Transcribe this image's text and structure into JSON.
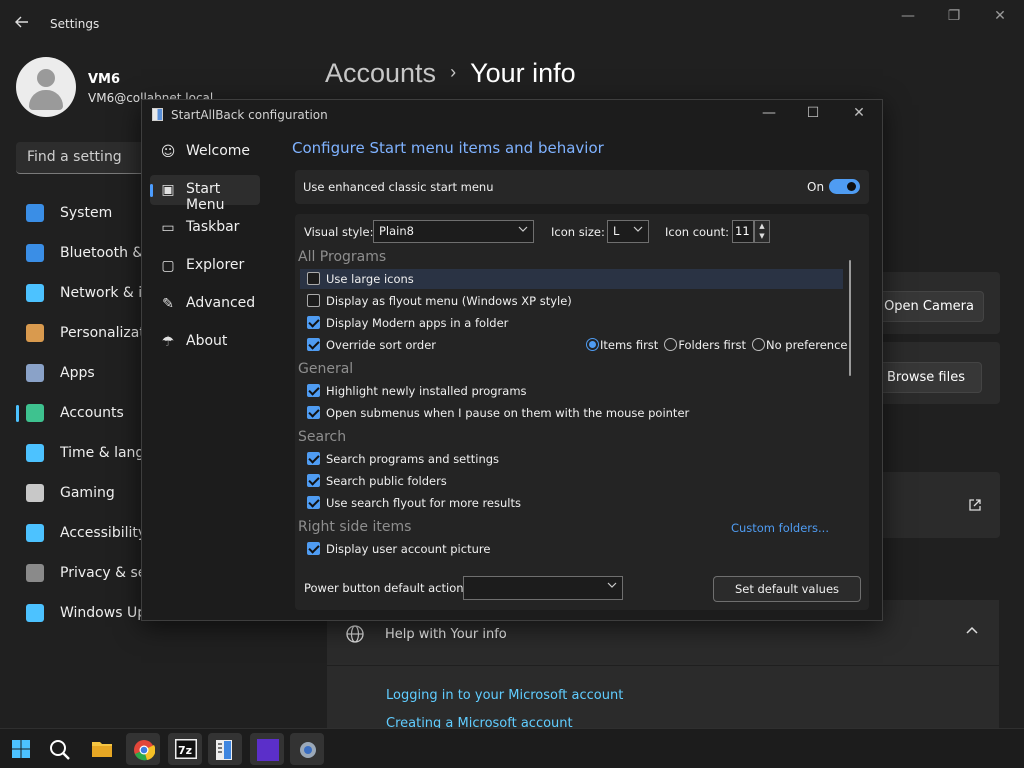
{
  "settings": {
    "title": "Settings",
    "user_name": "VM6",
    "user_email": "VM6@collabnet.local",
    "breadcrumb_parent": "Accounts",
    "breadcrumb_sep": "›",
    "breadcrumb_current": "Your info",
    "search_placeholder": "Find a setting",
    "nav": [
      {
        "label": "System",
        "icon": "system-icon",
        "color": "#3a8ee6"
      },
      {
        "label": "Bluetooth & devices",
        "icon": "bluetooth-icon",
        "color": "#3a8ee6"
      },
      {
        "label": "Network & internet",
        "icon": "wifi-icon",
        "color": "#4cc2ff"
      },
      {
        "label": "Personalization",
        "icon": "brush-icon",
        "color": "#d99a4e"
      },
      {
        "label": "Apps",
        "icon": "apps-icon",
        "color": "#8aa2c8"
      },
      {
        "label": "Accounts",
        "icon": "person-icon",
        "color": "#3ec28f"
      },
      {
        "label": "Time & language",
        "icon": "clock-globe-icon",
        "color": "#4cc2ff"
      },
      {
        "label": "Gaming",
        "icon": "gamepad-icon",
        "color": "#c8c8c8"
      },
      {
        "label": "Accessibility",
        "icon": "accessibility-icon",
        "color": "#4cc2ff"
      },
      {
        "label": "Privacy & security",
        "icon": "shield-icon",
        "color": "#8a8a8a"
      },
      {
        "label": "Windows Update",
        "icon": "update-icon",
        "color": "#4cc2ff"
      }
    ],
    "open_camera": "Open Camera",
    "browse_files": "Browse files",
    "external_link_icon": "external-link-icon",
    "help_title": "Help with Your info",
    "help_links": [
      "Logging in to your Microsoft account",
      "Creating a Microsoft account"
    ]
  },
  "dialog": {
    "title": "StartAllBack configuration",
    "nav": [
      {
        "label": "Welcome",
        "icon": "smile-icon",
        "glyph": "☺"
      },
      {
        "label": "Start Menu",
        "icon": "start-menu-icon",
        "glyph": "▣"
      },
      {
        "label": "Taskbar",
        "icon": "taskbar-icon",
        "glyph": "▭"
      },
      {
        "label": "Explorer",
        "icon": "explorer-icon",
        "glyph": "▢"
      },
      {
        "label": "Advanced",
        "icon": "wrench-icon",
        "glyph": "✎"
      },
      {
        "label": "About",
        "icon": "about-icon",
        "glyph": "☂"
      }
    ],
    "heading": "Configure Start menu items and behavior",
    "enhanced_label": "Use enhanced classic start menu",
    "enhanced_state": "On",
    "visual_style_label": "Visual style:",
    "visual_style_value": "Plain8",
    "icon_size_label": "Icon size:",
    "icon_size_value": "L",
    "icon_count_label": "Icon count:",
    "icon_count_value": "11",
    "sections": {
      "all_programs": "All Programs",
      "general": "General",
      "search": "Search",
      "right_side": "Right side items"
    },
    "options": [
      {
        "label": "Use large icons",
        "checked": false
      },
      {
        "label": "Display as flyout menu (Windows XP style)",
        "checked": false
      },
      {
        "label": "Display Modern apps in a folder",
        "checked": true
      },
      {
        "label": "Override sort order",
        "checked": true
      },
      {
        "label": "Highlight newly installed programs",
        "checked": true
      },
      {
        "label": "Open submenus when I pause on them with the mouse pointer",
        "checked": true
      },
      {
        "label": "Search programs and settings",
        "checked": true
      },
      {
        "label": "Search public folders",
        "checked": true
      },
      {
        "label": "Use search flyout for more results",
        "checked": true
      },
      {
        "label": "Display user account picture",
        "checked": true
      }
    ],
    "sort_options": [
      "Items first",
      "Folders first",
      "No preference"
    ],
    "sort_selected": "Items first",
    "custom_folders": "Custom folders...",
    "power_label": "Power button default action:",
    "power_value": "",
    "set_default": "Set default values"
  },
  "taskbar": {
    "apps": [
      "windows-start-icon",
      "search-icon",
      "file-explorer-icon",
      "chrome-icon",
      "7zip-icon",
      "startallback-icon",
      "purple-app-icon",
      "settings-gear-icon"
    ]
  }
}
